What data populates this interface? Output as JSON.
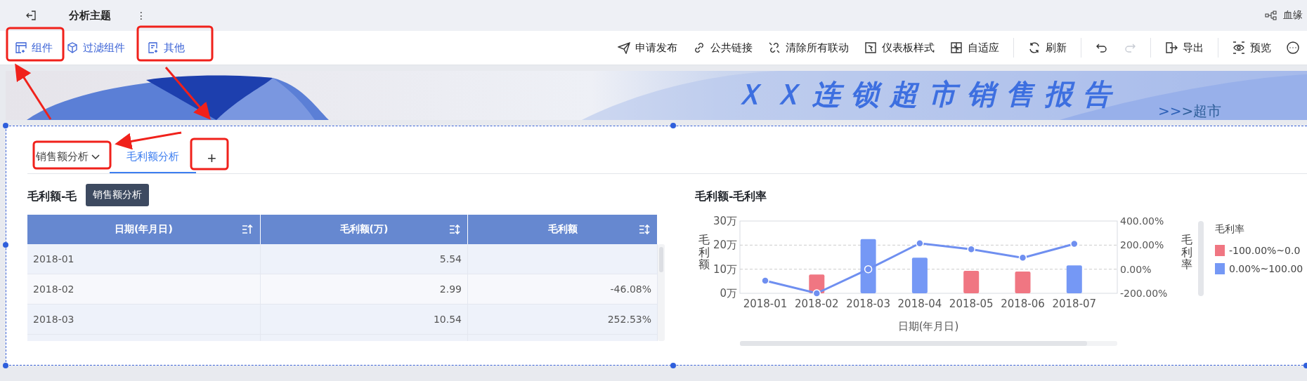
{
  "topbar": {
    "title": "分析主题",
    "more": "⋮",
    "right_label": "血缘"
  },
  "toolbar": {
    "left": [
      {
        "label": "组件"
      },
      {
        "label": "过滤组件"
      },
      {
        "label": "其他"
      }
    ],
    "right": [
      {
        "label": "申请发布"
      },
      {
        "label": "公共链接"
      },
      {
        "label": "清除所有联动"
      },
      {
        "label": "仪表板样式"
      },
      {
        "label": "自适应"
      },
      {
        "label": "刷新"
      },
      {
        "disabled": false
      },
      {
        "disabled": true
      },
      {
        "label": "导出"
      },
      {
        "label": "预览"
      }
    ]
  },
  "banner": {
    "title": "ＸＸ连锁超市销售报告",
    "crumb_prefix": ">>",
    "crumb": ">超市"
  },
  "tabs": [
    {
      "label": "销售额分析",
      "selected": false
    },
    {
      "label": "毛利额分析",
      "selected": true
    }
  ],
  "add_tab": "+",
  "tooltip": "销售额分析",
  "table_panel": {
    "title": "毛利额-毛",
    "columns": [
      {
        "label": "日期(年月日)"
      },
      {
        "label": "毛利额(万)"
      },
      {
        "label": "毛利额"
      }
    ],
    "rows": [
      {
        "cells": [
          "2018-01",
          "5.54",
          null
        ]
      },
      {
        "cells": [
          "2018-02",
          "2.99",
          "-46.08%"
        ]
      },
      {
        "cells": [
          "2018-03",
          "10.54",
          "252.53%"
        ]
      }
    ]
  },
  "chart_panel": {
    "title": "毛利额-毛利率",
    "chart_data": {
      "type": "bar",
      "xlabel": "日期(年月日)",
      "ylabel": "毛利额",
      "categories": [
        "2018-01",
        "2018-02",
        "2018-03",
        "2018-04",
        "2018-05",
        "2018-06",
        "2018-07"
      ],
      "series": [
        {
          "name": "-100.00%~0.0",
          "color": "#f07682",
          "values": [
            null,
            7.8,
            null,
            null,
            9.3,
            9.0,
            null
          ]
        },
        {
          "name": "0.00%~100.00",
          "color": "#7598f5",
          "values": [
            null,
            null,
            22.5,
            14.8,
            null,
            null,
            11.6
          ]
        }
      ],
      "ylim": [
        0,
        30
      ],
      "yticks": [
        {
          "value": 0,
          "label": "0万"
        },
        {
          "value": 10,
          "label": "10万"
        },
        {
          "value": 20,
          "label": "20万"
        },
        {
          "value": 30,
          "label": "30万"
        }
      ]
    },
    "rate_chart": {
      "chart_data": {
        "type": "line",
        "ylabel": "毛利率",
        "series": [
          {
            "name": "毛利率",
            "color": "#6f8ff0",
            "marker": true,
            "values": [
              -95,
              -200,
              0,
              215,
              165,
              95,
              210
            ]
          }
        ],
        "ylim": [
          -200,
          400
        ],
        "yticks": [
          {
            "value": -200,
            "label": "-200.00%"
          },
          {
            "value": 0,
            "label": "0.00%"
          },
          {
            "value": 200,
            "label": "200.00%"
          },
          {
            "value": 400,
            "label": "400.00%"
          }
        ]
      }
    }
  }
}
